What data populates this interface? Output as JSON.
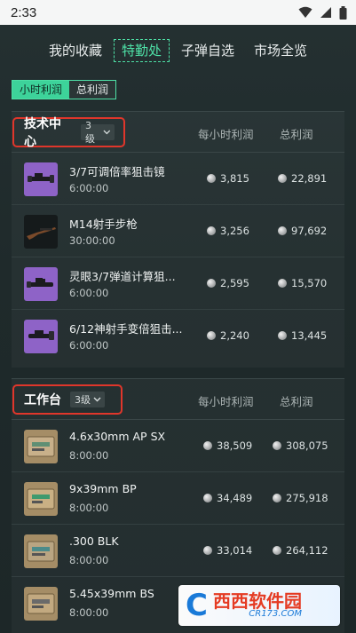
{
  "status_bar": {
    "time": "2:33"
  },
  "top_nav": [
    "我的收藏",
    "特勤处",
    "子弹自选",
    "市场全览"
  ],
  "top_nav_active": 1,
  "subtabs": [
    "小时利润",
    "总利润"
  ],
  "subtabs_active": 0,
  "sections": [
    {
      "name": "技术中心",
      "level": "3级",
      "col_hour": "每小时利润",
      "col_total": "总利润",
      "items": [
        {
          "name": "3/7可调倍率狙击镜",
          "time": "6:00:00",
          "hour": "3,815",
          "total": "22,891",
          "thumb": "scope-purple"
        },
        {
          "name": "M14射手步枪",
          "time": "30:00:00",
          "hour": "3,256",
          "total": "97,692",
          "thumb": "rifle-dark"
        },
        {
          "name": "灵眼3/7弹道计算狙...",
          "time": "6:00:00",
          "hour": "2,595",
          "total": "15,570",
          "thumb": "scope-purple"
        },
        {
          "name": "6/12神射手变倍狙击...",
          "time": "6:00:00",
          "hour": "2,240",
          "total": "13,445",
          "thumb": "scope-purple"
        }
      ]
    },
    {
      "name": "工作台",
      "level": "3级",
      "col_hour": "每小时利润",
      "col_total": "总利润",
      "items": [
        {
          "name": "4.6x30mm AP SX",
          "time": "8:00:00",
          "hour": "38,509",
          "total": "308,075",
          "thumb": "ammo-box"
        },
        {
          "name": "9x39mm BP",
          "time": "8:00:00",
          "hour": "34,489",
          "total": "275,918",
          "thumb": "ammo-box"
        },
        {
          "name": ".300 BLK",
          "time": "8:00:00",
          "hour": "33,014",
          "total": "264,112",
          "thumb": "ammo-box"
        },
        {
          "name": "5.45x39mm BS",
          "time": "8:00:00",
          "hour": "",
          "total": "",
          "thumb": "ammo-box"
        }
      ]
    }
  ],
  "watermark": {
    "logo_letter": "C",
    "title": "西西软件园",
    "url": "CR173.COM"
  },
  "colors": {
    "accent": "#3dd39a",
    "highlight_box": "#e0362b",
    "scope_bg": "#8e63c7"
  }
}
